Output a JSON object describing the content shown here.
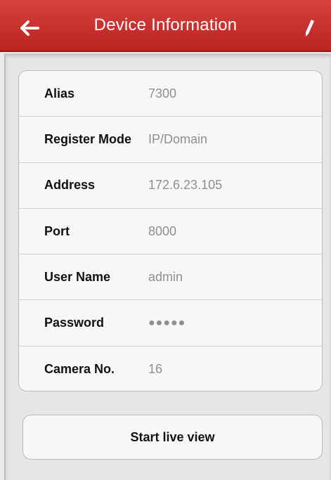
{
  "header": {
    "title": "Device Information",
    "back_icon": "arrow-left-icon",
    "edit_icon": "pencil-icon",
    "bar_color": "#c7302c"
  },
  "fields": [
    {
      "label": "Alias",
      "value": "7300"
    },
    {
      "label": "Register Mode",
      "value": "IP/Domain"
    },
    {
      "label": "Address",
      "value": "172.6.23.105"
    },
    {
      "label": "Port",
      "value": "8000"
    },
    {
      "label": "User Name",
      "value": "admin"
    },
    {
      "label": "Password",
      "value": "●●●●●"
    },
    {
      "label": "Camera No.",
      "value": "16"
    }
  ],
  "actions": {
    "start_live_view": "Start live view"
  }
}
